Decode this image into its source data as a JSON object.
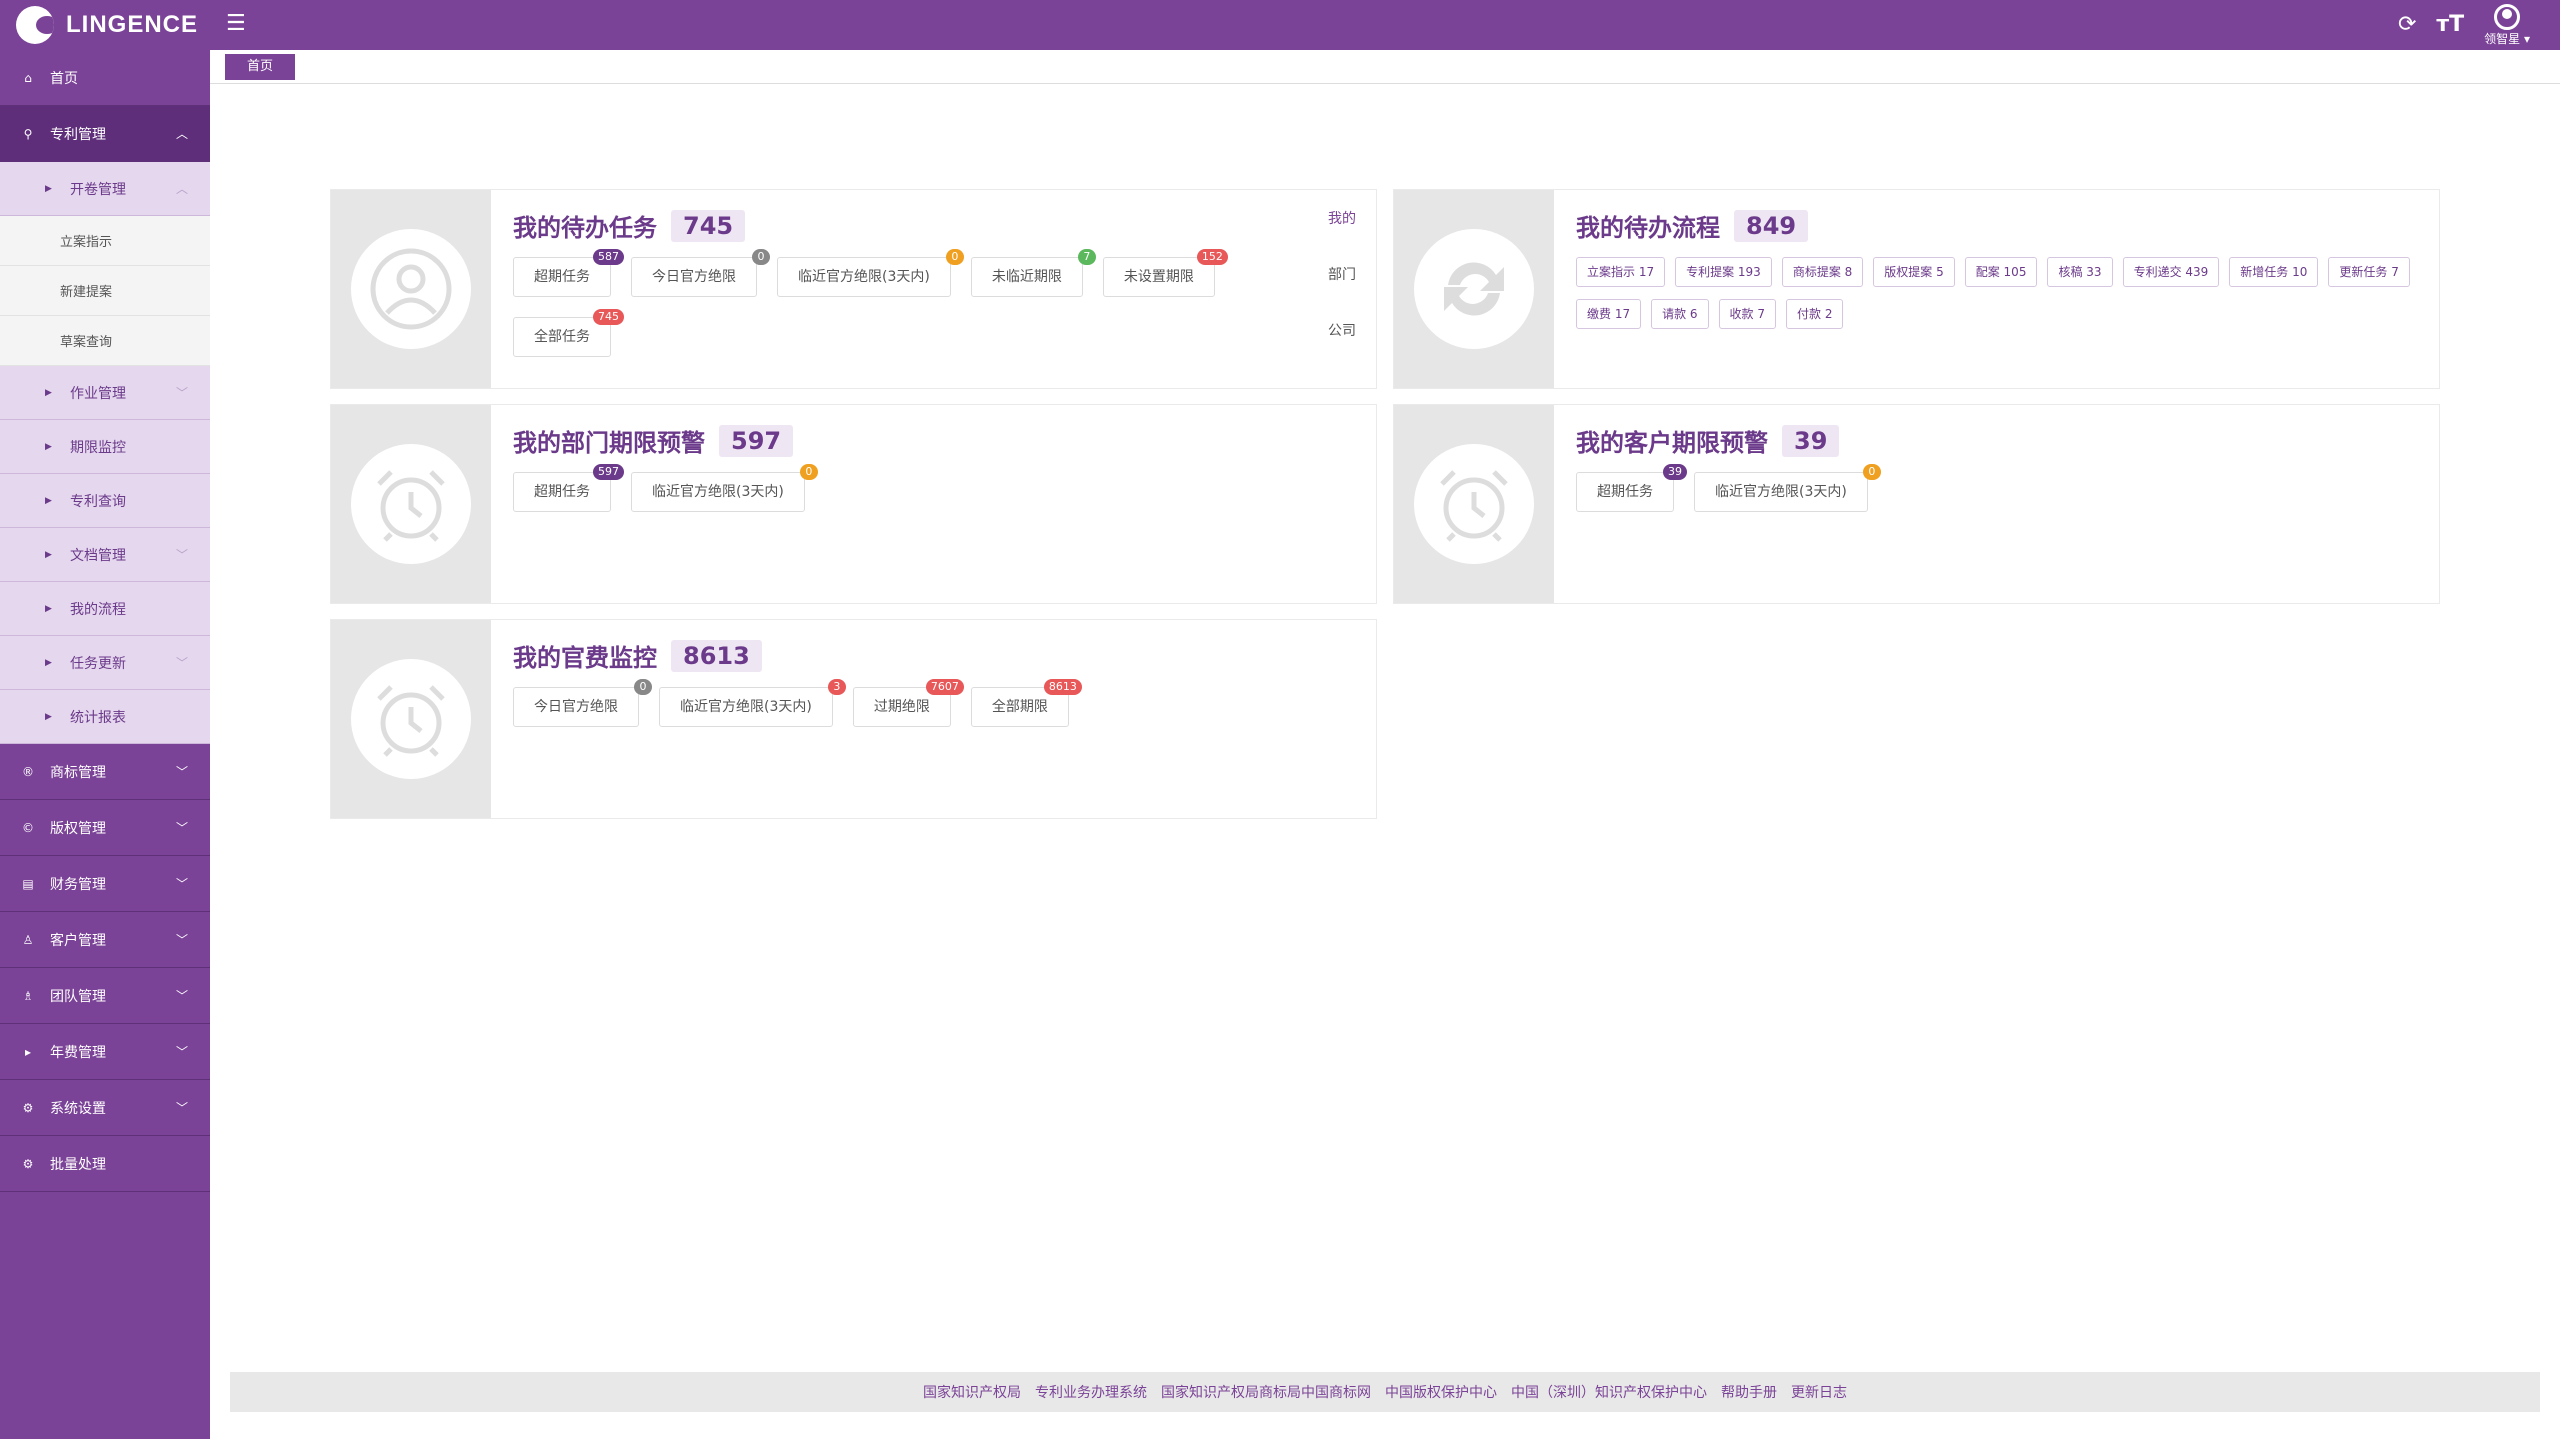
{
  "header": {
    "logo_text": "LINGENCE",
    "user_name": "领智星"
  },
  "sidebar": {
    "home": "首页",
    "patent": "专利管理",
    "patent_sub": {
      "case_mgmt": "开卷管理",
      "case_leaves": [
        "立案指示",
        "新建提案",
        "草案查询"
      ],
      "others": [
        "作业管理",
        "期限监控",
        "专利查询",
        "文档管理",
        "我的流程",
        "任务更新",
        "统计报表"
      ]
    },
    "groups": [
      "商标管理",
      "版权管理",
      "财务管理",
      "客户管理",
      "团队管理",
      "年费管理",
      "系统设置",
      "批量处理"
    ]
  },
  "tabs": {
    "home": "首页"
  },
  "todo_tasks": {
    "title": "我的待办任务",
    "count": "745",
    "buttons": [
      {
        "label": "超期任务",
        "badge": "587"
      },
      {
        "label": "今日官方绝限",
        "badge": "0"
      },
      {
        "label": "临近官方绝限(3天内)",
        "badge": "0"
      },
      {
        "label": "未临近期限",
        "badge": "7"
      },
      {
        "label": "未设置期限",
        "badge": "152"
      },
      {
        "label": "全部任务",
        "badge": "745"
      }
    ],
    "scope": [
      "我的",
      "部门",
      "公司"
    ]
  },
  "todo_flows": {
    "title": "我的待办流程",
    "count": "849",
    "tags": [
      "立案指示 17",
      "专利提案 193",
      "商标提案 8",
      "版权提案 5",
      "配案 105",
      "核稿 33",
      "专利递交 439",
      "新增任务 10",
      "更新任务 7",
      "缴费 17",
      "请款 6",
      "收款 7",
      "付款 2"
    ]
  },
  "dept_alert": {
    "title": "我的部门期限预警",
    "count": "597",
    "buttons": [
      {
        "label": "超期任务",
        "badge": "597"
      },
      {
        "label": "临近官方绝限(3天内)",
        "badge": "0"
      }
    ]
  },
  "client_alert": {
    "title": "我的客户期限预警",
    "count": "39",
    "buttons": [
      {
        "label": "超期任务",
        "badge": "39"
      },
      {
        "label": "临近官方绝限(3天内)",
        "badge": "0"
      }
    ]
  },
  "fee_monitor": {
    "title": "我的官费监控",
    "count": "8613",
    "buttons": [
      {
        "label": "今日官方绝限",
        "badge": "0"
      },
      {
        "label": "临近官方绝限(3天内)",
        "badge": "3"
      },
      {
        "label": "过期绝限",
        "badge": "7607"
      },
      {
        "label": "全部期限",
        "badge": "8613"
      }
    ]
  },
  "footer": {
    "links": [
      "国家知识产权局",
      "专利业务办理系统",
      "国家知识产权局商标局中国商标网",
      "中国版权保护中心",
      "中国（深圳）知识产权保护中心",
      "帮助手册",
      "更新日志"
    ]
  },
  "colors": {
    "primary": "#7b4397",
    "badge_red": "#e85858",
    "badge_orange": "#f0a020",
    "badge_green": "#5cb85c",
    "badge_gray": "#888888"
  }
}
